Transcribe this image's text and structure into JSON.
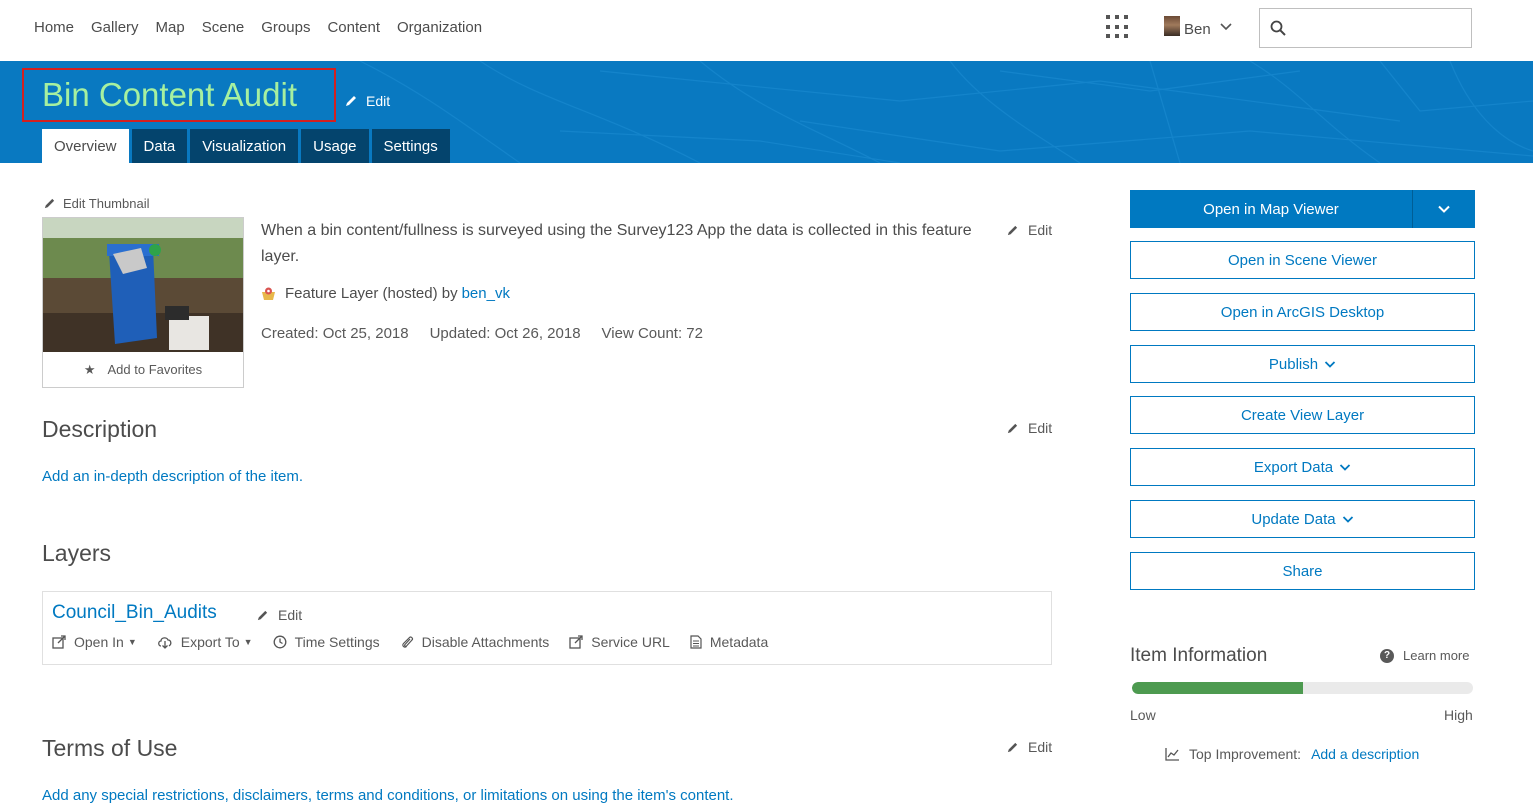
{
  "nav": {
    "links": [
      "Home",
      "Gallery",
      "Map",
      "Scene",
      "Groups",
      "Content",
      "Organization"
    ],
    "user_name": "Ben",
    "search_placeholder": ""
  },
  "item": {
    "title": "Bin Content Audit",
    "title_edit": "Edit",
    "tabs": [
      "Overview",
      "Data",
      "Visualization",
      "Usage",
      "Settings"
    ],
    "active_tab": "Overview"
  },
  "overview": {
    "edit_thumbnail": "Edit Thumbnail",
    "add_to_favorites": "Add to Favorites",
    "summary": "When a bin content/fullness is surveyed using the Survey123 App the data is collected in this feature layer.",
    "summary_edit": "Edit",
    "item_type": "Feature Layer (hosted) by",
    "owner": "ben_vk",
    "created": "Created: Oct 25, 2018",
    "updated": "Updated: Oct 26, 2018",
    "view_count": "View Count: 72"
  },
  "description": {
    "heading": "Description",
    "edit": "Edit",
    "placeholder_link": "Add an in-depth description of the item."
  },
  "layers": {
    "heading": "Layers",
    "layer_name": "Council_Bin_Audits",
    "edit": "Edit",
    "actions": [
      "Open In",
      "Export To",
      "Time Settings",
      "Disable Attachments",
      "Service URL",
      "Metadata"
    ]
  },
  "terms": {
    "heading": "Terms of Use",
    "edit": "Edit",
    "placeholder_link": "Add any special restrictions, disclaimers, terms and conditions, or limitations on using the item's content."
  },
  "actions": {
    "open_map_viewer": "Open in Map Viewer",
    "open_scene_viewer": "Open in Scene Viewer",
    "open_desktop": "Open in ArcGIS Desktop",
    "publish": "Publish",
    "create_view_layer": "Create View Layer",
    "export_data": "Export Data",
    "update_data": "Update Data",
    "share": "Share"
  },
  "item_information": {
    "heading": "Item Information",
    "learn_more": "Learn more",
    "score_fraction": 0.5,
    "low_label": "Low",
    "high_label": "High",
    "top_improvement_label": "Top Improvement:",
    "top_improvement_link": "Add a description"
  },
  "colors": {
    "brand_blue": "#0079c1",
    "banner_blue": "#0979c1",
    "tab_dark": "#04446d",
    "title_green": "#a6f0a0",
    "highlight_red": "#d32020",
    "meter_green": "#4d9a50"
  },
  "icons": [
    "apps-grid-icon",
    "chevron-down-icon",
    "search-icon",
    "pencil-icon",
    "star-icon",
    "feature-layer-icon",
    "open-in-icon",
    "export-icon",
    "clock-icon",
    "paperclip-icon",
    "external-link-icon",
    "metadata-icon",
    "help-icon",
    "improvement-chart-icon"
  ]
}
